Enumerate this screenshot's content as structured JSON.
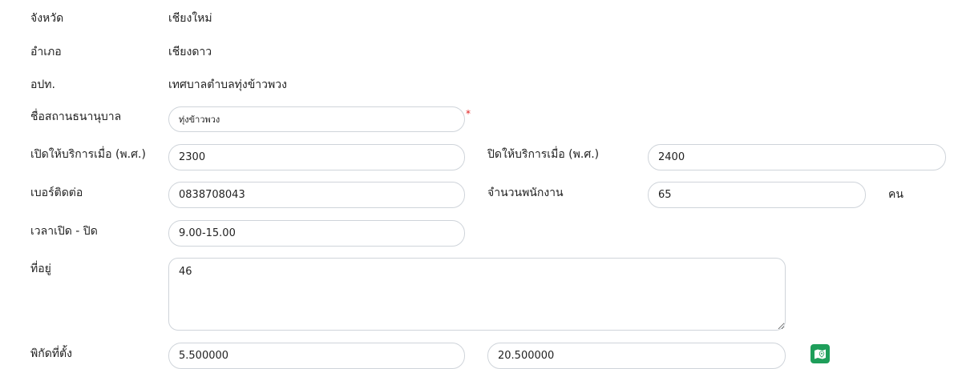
{
  "info": {
    "province_label": "จังหวัด",
    "province_value": "เชียงใหม่",
    "district_label": "อำเภอ",
    "district_value": "เชียงดาว",
    "lao_label": "อปท.",
    "lao_value": "เทศบาลตำบลทุ่งข้าวพวง"
  },
  "form": {
    "bank_name_label": "ชื่อสถานธนานุบาล",
    "bank_name_value": "ทุ่งข้าวพวง",
    "required_mark": "*",
    "open_year_label": "เปิดให้บริการเมื่อ (พ.ศ.)",
    "open_year_value": "2300",
    "close_year_label": "ปิดให้บริการเมื่อ (พ.ศ.)",
    "close_year_value": "2400",
    "phone_label": "เบอร์ติดต่อ",
    "phone_value": "0838708043",
    "staff_label": "จำนวนพนักงาน",
    "staff_value": "65",
    "staff_unit": "คน",
    "hours_label": "เวลาเปิด - ปิด",
    "hours_value": "9.00-15.00",
    "address_label": "ที่อยู่",
    "address_value": "46",
    "coords_label": "พิกัดที่ตั้ง",
    "latitude_value": "5.500000",
    "longitude_value": "20.500000",
    "map_icon": "map-marker-icon",
    "map_button_color": "#1e9e5a"
  }
}
